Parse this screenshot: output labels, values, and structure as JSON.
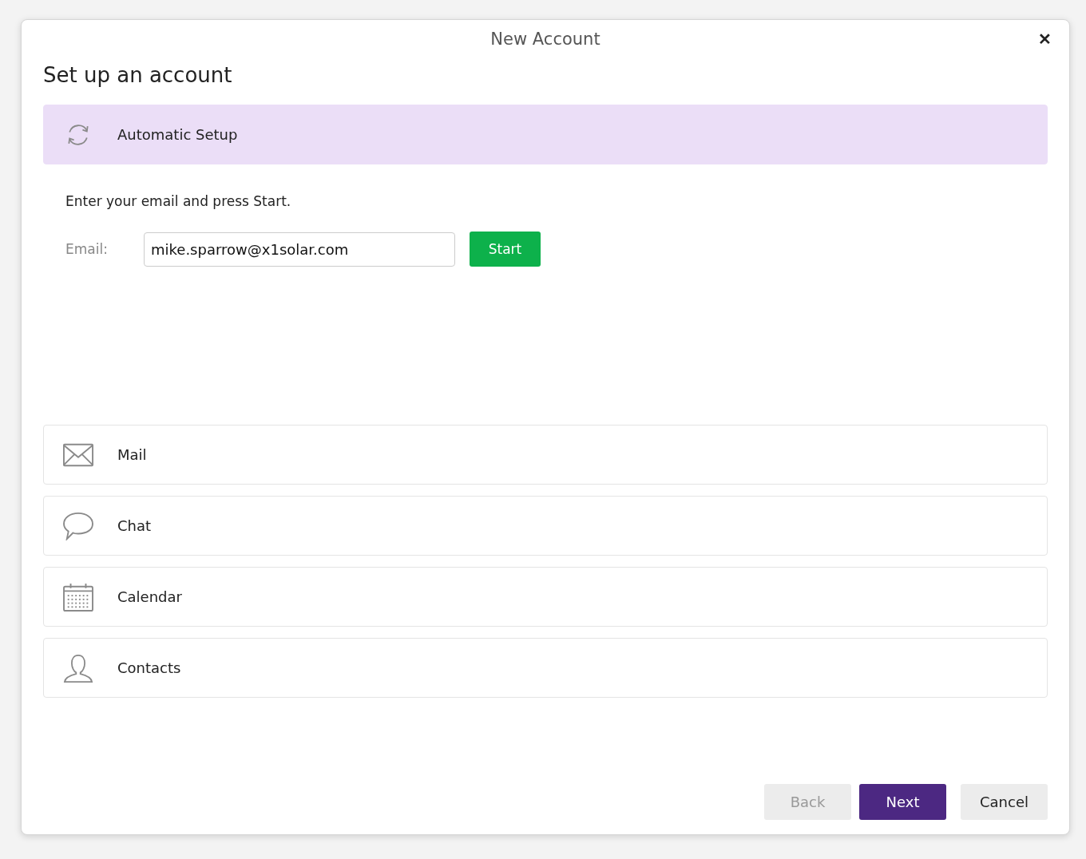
{
  "window": {
    "title": "New Account",
    "close": "✕"
  },
  "heading": "Set up an account",
  "options": [
    {
      "label": "Automatic Setup",
      "kind": "sync",
      "selected": true,
      "details": {
        "instruction": "Enter your email and press Start.",
        "email_label": "Email:",
        "email_value": "mike.sparrow@x1solar.com",
        "start_button": "Start"
      }
    },
    {
      "label": "Mail",
      "kind": "mail",
      "selected": false
    },
    {
      "label": "Chat",
      "kind": "chat",
      "selected": false
    },
    {
      "label": "Calendar",
      "kind": "calendar",
      "selected": false
    },
    {
      "label": "Contacts",
      "kind": "contacts",
      "selected": false
    }
  ],
  "buttons": [
    {
      "label": "Back",
      "kind": "default",
      "disabled": true
    },
    {
      "label": "Next",
      "kind": "primary",
      "disabled": false
    },
    {
      "label": "Cancel",
      "kind": "default",
      "disabled": false
    }
  ]
}
